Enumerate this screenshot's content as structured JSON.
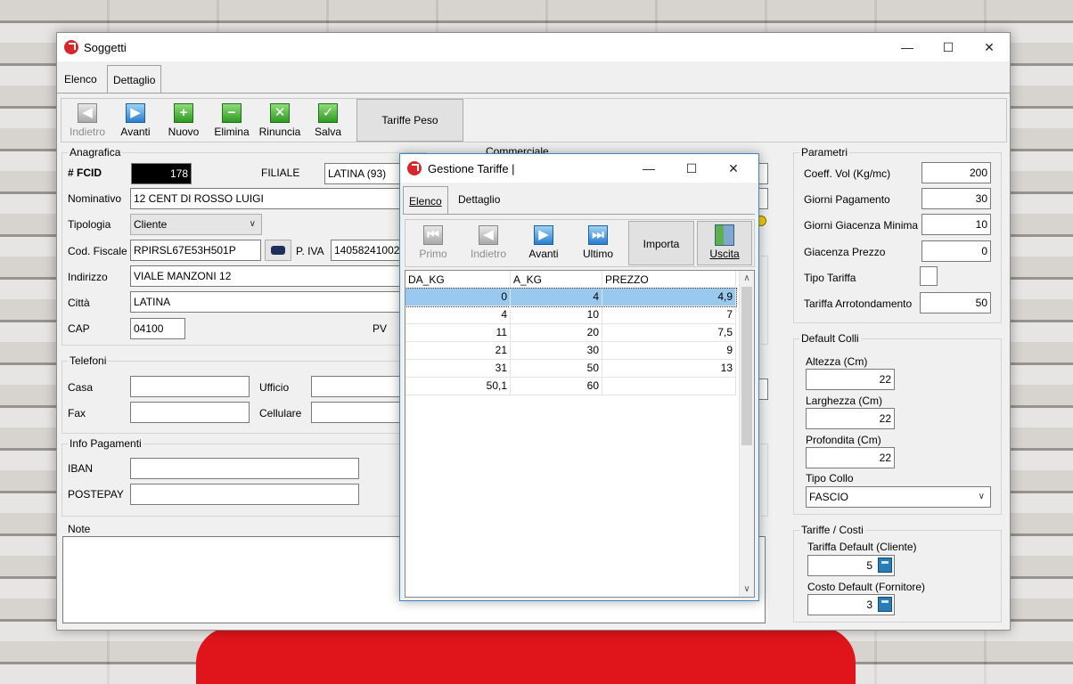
{
  "main_window": {
    "title": "Soggetti",
    "controls": {
      "minimize": "—",
      "maximize": "☐",
      "close": "✕"
    },
    "tabs": [
      {
        "label": "Elenco"
      },
      {
        "label": "Dettaglio"
      }
    ],
    "toolbar": {
      "indietro": "Indietro",
      "avanti": "Avanti",
      "nuovo": "Nuovo",
      "elimina": "Elimina",
      "rinuncia": "Rinuncia",
      "salva": "Salva",
      "tariffe_peso": "Tariffe Peso"
    },
    "anagrafica": {
      "title": "Anagrafica",
      "fcid_label": "# FCID",
      "fcid_value": "178",
      "filiale_label": "FILIALE",
      "filiale_value": "LATINA (93)",
      "nominativo_label": "Nominativo",
      "nominativo_value": "12 CENT DI ROSSO LUIGI",
      "tipologia_label": "Tipologia",
      "tipologia_value": "Cliente",
      "cf_label": "Cod. Fiscale",
      "cf_value": "RPIRSL67E53H501P",
      "piva_label": "P. IVA",
      "piva_value": "14058241002",
      "indirizzo_label": "Indirizzo",
      "indirizzo_value": "VIALE MANZONI 12",
      "citta_label": "Città",
      "citta_value": "LATINA",
      "cap_label": "CAP",
      "cap_value": "04100",
      "pv_label": "PV"
    },
    "telefoni": {
      "title": "Telefoni",
      "casa_label": "Casa",
      "ufficio_label": "Ufficio",
      "fax_label": "Fax",
      "cellulare_label": "Cellulare"
    },
    "info_pagamenti": {
      "title": "Info Pagamenti",
      "iban_label": "IBAN",
      "postepay_label": "POSTEPAY"
    },
    "note": {
      "title": "Note"
    },
    "commerciale": {
      "title": "Commerciale"
    },
    "parametri": {
      "title": "Parametri",
      "coeff_label": "Coeff. Vol (Kg/mc)",
      "coeff_value": "200",
      "giorni_pag_label": "Giorni Pagamento",
      "giorni_pag_value": "30",
      "giacenza_min_label": "Giorni Giacenza Minima",
      "giacenza_min_value": "10",
      "giacenza_prezzo_label": "Giacenza Prezzo",
      "giacenza_prezzo_value": "0",
      "tipo_tariffa_label": "Tipo Tariffa",
      "arrotondamento_label": "Tariffa Arrotondamento",
      "arrotondamento_value": "50"
    },
    "default_colli": {
      "title": "Default Colli",
      "altezza_label": "Altezza (Cm)",
      "altezza_value": "22",
      "larghezza_label": "Larghezza (Cm)",
      "larghezza_value": "22",
      "profondita_label": "Profondita (Cm)",
      "profondita_value": "22",
      "tipo_collo_label": "Tipo Collo",
      "tipo_collo_value": "FASCIO"
    },
    "tariffe_costi": {
      "title": "Tariffe / Costi",
      "tariffa_default_label": "Tariffa Default (Cliente)",
      "tariffa_default_value": "5",
      "costo_default_label": "Costo Default (Fornitore)",
      "costo_default_value": "3"
    }
  },
  "dialog": {
    "title": "Gestione Tariffe |",
    "controls": {
      "minimize": "—",
      "maximize": "☐",
      "close": "✕"
    },
    "tabs": [
      {
        "label": "Elenco"
      },
      {
        "label": "Dettaglio"
      }
    ],
    "toolbar": {
      "primo": "Primo",
      "indietro": "Indietro",
      "avanti": "Avanti",
      "ultimo": "Ultimo",
      "importa": "Importa",
      "uscita": "Uscita"
    },
    "grid": {
      "columns": [
        "DA_KG",
        "A_KG",
        "PREZZO"
      ],
      "rows": [
        [
          "0",
          "4",
          "4,9"
        ],
        [
          "4",
          "10",
          "7"
        ],
        [
          "11",
          "20",
          "7,5"
        ],
        [
          "21",
          "30",
          "9"
        ],
        [
          "31",
          "50",
          "13"
        ],
        [
          "50,1",
          "60",
          ""
        ]
      ]
    }
  }
}
